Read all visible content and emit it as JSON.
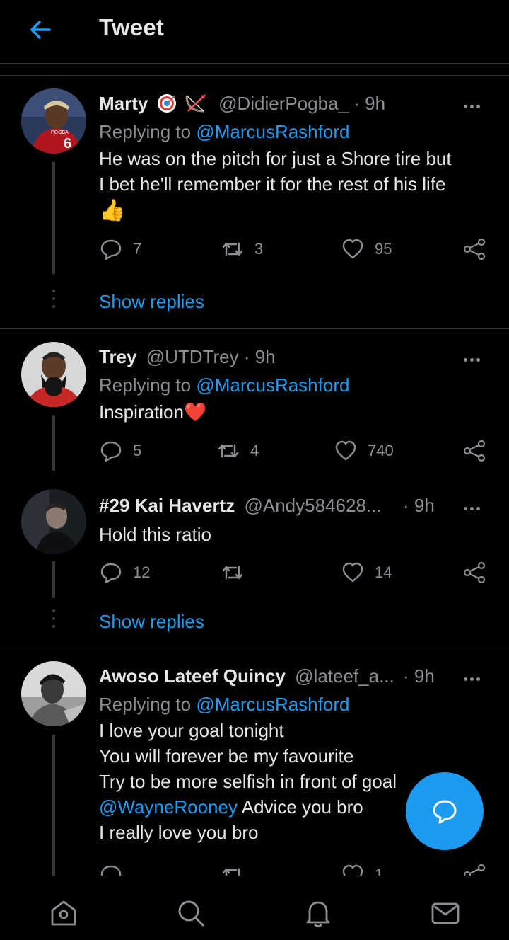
{
  "header": {
    "title": "Tweet"
  },
  "tweets": [
    {
      "name": "Marty",
      "handle": "@DidierPogba_",
      "time": "· 9h",
      "replying_prefix": "Replying to ",
      "replying_to": "@MarcusRashford",
      "line1": "He was on the pitch for just a Shore tire but",
      "line2": "I bet he'll remember it for the rest of his life",
      "emoji": "👍",
      "replies": "7",
      "retweets": "3",
      "likes": "95",
      "show_replies": "Show replies"
    },
    {
      "name": "Trey",
      "handle": "@UTDTrey",
      "time": "· 9h",
      "replying_prefix": "Replying to ",
      "replying_to": "@MarcusRashford",
      "line1": "Inspiration",
      "emoji": "❤️",
      "replies": "5",
      "retweets": "4",
      "likes": "740"
    },
    {
      "name": "#29 Kai Havertz",
      "handle": "@Andy584628...",
      "time": "· 9h",
      "line1": "Hold this ratio",
      "replies": "12",
      "retweets": "",
      "likes": "14",
      "show_replies": "Show replies"
    },
    {
      "name": "Awoso Lateef Quincy",
      "handle": "@lateef_a...",
      "time": "· 9h",
      "replying_prefix": "Replying to ",
      "replying_to": "@MarcusRashford",
      "line1": "I love your goal tonight",
      "line2": "You will forever be my favourite",
      "line3": "Try to be more selfish in front of goal",
      "mention": "@WayneRooney",
      "line4_rest": " Advice you bro",
      "line5": "I really love you bro",
      "replies": "",
      "retweets": "",
      "likes": "1"
    }
  ],
  "nav": [
    "home-icon",
    "search-icon",
    "notifications-icon",
    "messages-icon"
  ],
  "colors": {
    "accent": "#1d9bf0",
    "background": "#000000",
    "muted": "#8b8f93"
  }
}
